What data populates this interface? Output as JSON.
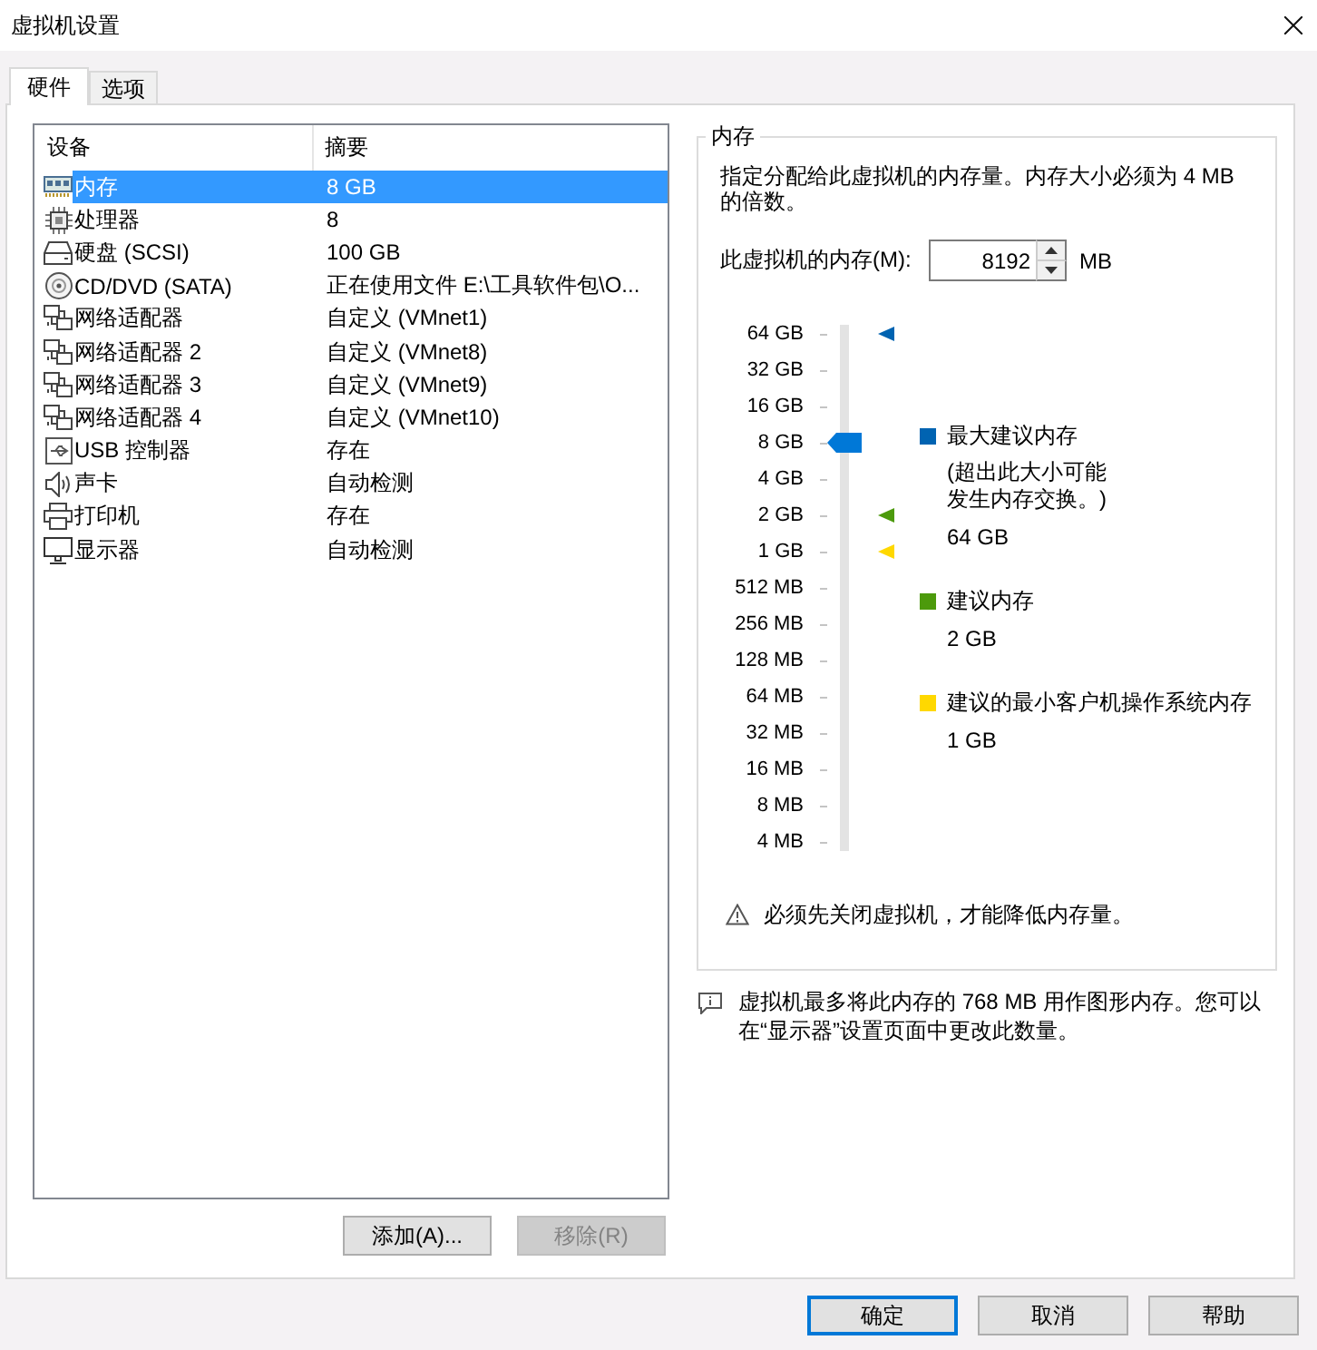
{
  "window": {
    "title": "虚拟机设置"
  },
  "tabs": [
    {
      "label": "硬件",
      "selected": true
    },
    {
      "label": "选项",
      "selected": false
    }
  ],
  "device_list": {
    "columns": [
      "设备",
      "摘要"
    ],
    "rows": [
      {
        "kind": "memory",
        "device": "内存",
        "summary": "8 GB",
        "selected": true
      },
      {
        "kind": "processor",
        "device": "处理器",
        "summary": "8",
        "selected": false
      },
      {
        "kind": "disk",
        "device": "硬盘 (SCSI)",
        "summary": "100 GB",
        "selected": false
      },
      {
        "kind": "cdrom",
        "device": "CD/DVD (SATA)",
        "summary": "正在使用文件 E:\\工具软件包\\O...",
        "selected": false
      },
      {
        "kind": "network",
        "device": "网络适配器",
        "summary": "自定义 (VMnet1)",
        "selected": false
      },
      {
        "kind": "network",
        "device": "网络适配器 2",
        "summary": "自定义 (VMnet8)",
        "selected": false
      },
      {
        "kind": "network",
        "device": "网络适配器 3",
        "summary": "自定义 (VMnet9)",
        "selected": false
      },
      {
        "kind": "network",
        "device": "网络适配器 4",
        "summary": "自定义 (VMnet10)",
        "selected": false
      },
      {
        "kind": "usb",
        "device": "USB 控制器",
        "summary": "存在",
        "selected": false
      },
      {
        "kind": "sound",
        "device": "声卡",
        "summary": "自动检测",
        "selected": false
      },
      {
        "kind": "printer",
        "device": "打印机",
        "summary": "存在",
        "selected": false
      },
      {
        "kind": "display",
        "device": "显示器",
        "summary": "自动检测",
        "selected": false
      }
    ]
  },
  "list_buttons": [
    {
      "label": "添加(A)...",
      "disabled": false
    },
    {
      "label": "移除(R)",
      "disabled": true
    }
  ],
  "memory": {
    "title": "内存",
    "description": "指定分配给此虚拟机的内存量。内存大小必须为 4 MB 的倍数。",
    "field_label": "此虚拟机的内存(M):",
    "value": "8192",
    "unit": "MB",
    "slider": {
      "level": 0.786,
      "ticks": [
        {
          "label": "64 GB",
          "color": "#0063b1"
        },
        {
          "label": "32 GB"
        },
        {
          "label": "16 GB"
        },
        {
          "label": "8 GB"
        },
        {
          "label": "4 GB"
        },
        {
          "label": "2 GB",
          "color": "#4c9a0c"
        },
        {
          "label": "1 GB",
          "color": "#ffd800"
        },
        {
          "label": "512 MB"
        },
        {
          "label": "256 MB"
        },
        {
          "label": "128 MB"
        },
        {
          "label": "64 MB"
        },
        {
          "label": "32 MB"
        },
        {
          "label": "16 MB"
        },
        {
          "label": "8 MB"
        },
        {
          "label": "4 MB"
        }
      ]
    },
    "legend": [
      {
        "color": "#0063b1",
        "label": "最大建议内存",
        "note": "(超出此大小可能发生内存交换。)",
        "value": "64 GB"
      },
      {
        "color": "#4c9a0c",
        "label": "建议内存",
        "value": "2 GB"
      },
      {
        "color": "#ffd800",
        "label": "建议的最小客户机操作系统内存",
        "value": "1 GB"
      }
    ],
    "warning": "必须先关闭虚拟机，才能降低内存量。"
  },
  "info": "虚拟机最多将此内存的 768 MB 用作图形内存。您可以在“显示器”设置页面中更改此数量。",
  "dialog_buttons": [
    {
      "label": "确定",
      "default": true
    },
    {
      "label": "取消",
      "default": false
    },
    {
      "label": "帮助",
      "default": false
    }
  ]
}
